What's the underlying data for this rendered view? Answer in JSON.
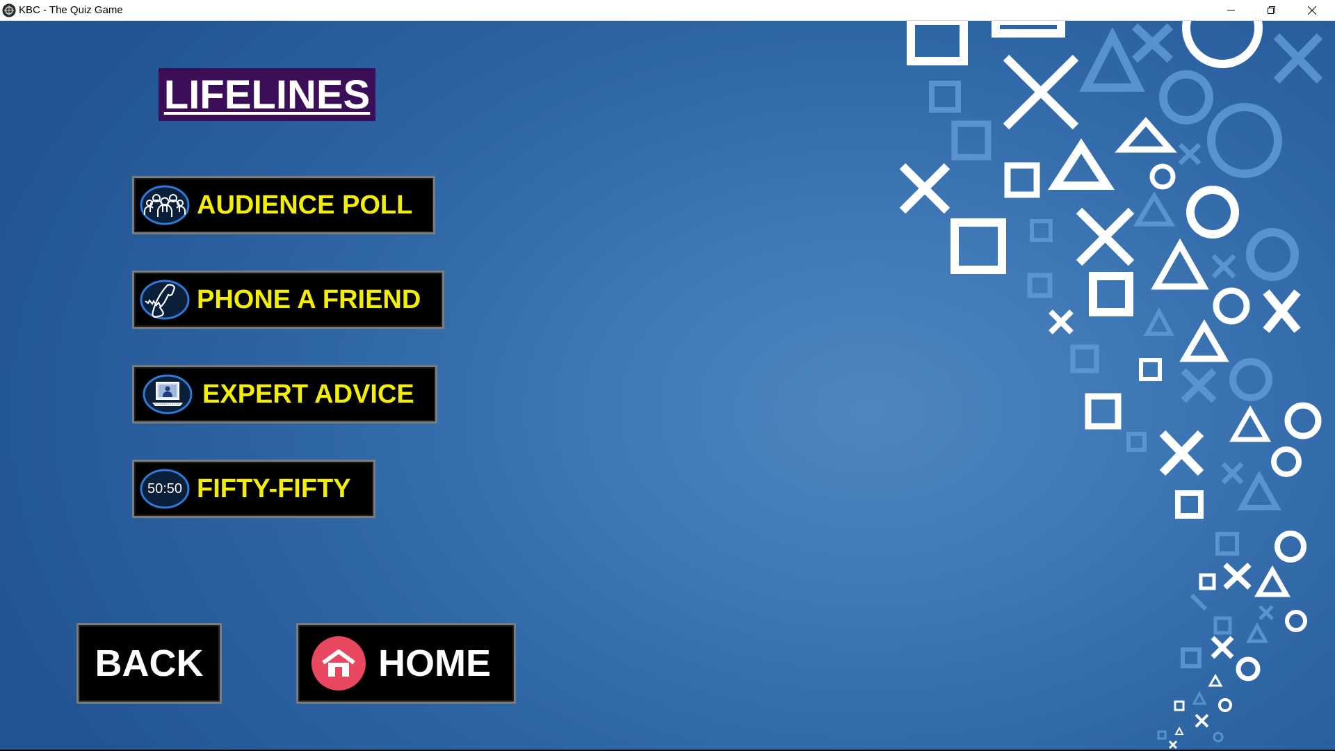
{
  "window": {
    "title": "KBC - The Quiz Game",
    "controls": [
      "minimize-icon",
      "restore-icon",
      "close-icon"
    ]
  },
  "page": {
    "heading": "LIFELINES"
  },
  "lifelines": [
    {
      "label": "AUDIENCE POLL",
      "icon": "audience-icon"
    },
    {
      "label": "PHONE A FRIEND",
      "icon": "phone-icon"
    },
    {
      "label": "EXPERT ADVICE",
      "icon": "expert-laptop-icon"
    },
    {
      "label": "FIFTY-FIFTY",
      "icon": "fifty-fifty-icon",
      "icon_text": "50:50"
    }
  ],
  "nav": {
    "back_label": "BACK",
    "home_label": "HOME",
    "home_icon": "home-icon"
  },
  "colors": {
    "lifeline_text": "#f4ef00",
    "title_bg": "#3b0f57",
    "background": "#3f78b6",
    "home_circle": "#e8475f"
  }
}
